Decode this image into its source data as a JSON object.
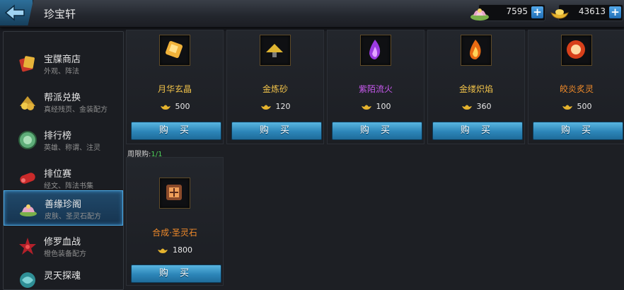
{
  "header": {
    "title": "珍宝轩",
    "currencies": [
      {
        "icon": "lotus-token-icon",
        "value": "7595"
      },
      {
        "icon": "gold-ingot-icon",
        "value": "43613"
      }
    ]
  },
  "sidebar": {
    "items": [
      {
        "icon": "red-envelope-icon",
        "label": "宝牒商店",
        "sub": "外观、阵法"
      },
      {
        "icon": "gold-treasure-icon",
        "label": "帮派兑换",
        "sub": "真经残页、金装配方"
      },
      {
        "icon": "jade-medal-icon",
        "label": "排行榜",
        "sub": "英雄、称谓、注灵"
      },
      {
        "icon": "red-scroll-icon",
        "label": "排位赛",
        "sub": "经文、阵法书集"
      },
      {
        "icon": "lotus-altar-icon",
        "label": "善缘珍阁",
        "sub": "皮肤、圣灵石配方"
      },
      {
        "icon": "crimson-flower-icon",
        "label": "修罗血战",
        "sub": "橙色装备配方"
      },
      {
        "icon": "teal-swirl-icon",
        "label": "灵天探魂",
        "sub": ""
      }
    ],
    "active_index": 4
  },
  "shop": {
    "buy_label": "购 买",
    "items": [
      {
        "name": "月华玄晶",
        "price": "500",
        "color": "#f2c34a",
        "icon": "golden-crystal-icon"
      },
      {
        "name": "金炼砂",
        "price": "120",
        "color": "#f2c34a",
        "icon": "gold-sand-icon"
      },
      {
        "name": "紫陌流火",
        "price": "100",
        "color": "#c95af0",
        "icon": "purple-flame-icon"
      },
      {
        "name": "金缕炽焰",
        "price": "360",
        "color": "#f2c34a",
        "icon": "golden-flame-icon"
      },
      {
        "name": "皎炎炙灵",
        "price": "500",
        "color": "#f08a2a",
        "icon": "fire-orb-icon"
      },
      {
        "name": "合成·圣灵石",
        "price": "1800",
        "color": "#f08a2a",
        "icon": "recipe-scroll-icon"
      }
    ],
    "weekly_limit_label": "周限购:",
    "weekly_limit_count": "1/1"
  }
}
